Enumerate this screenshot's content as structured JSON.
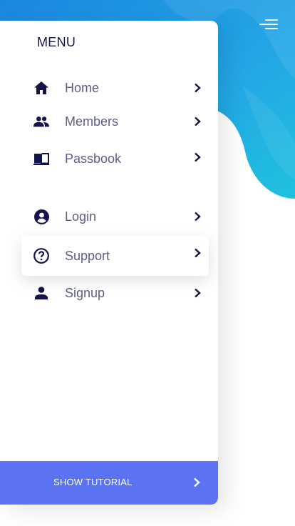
{
  "colors": {
    "accent": "#5b73f2",
    "background_wave_light": "#29b7e4",
    "background_wave_dark": "#1a8fe0",
    "menu_title": "#14134a",
    "item_text": "#5d5f86"
  },
  "header": {
    "menu_button_icon": "hamburger-icon"
  },
  "drawer": {
    "title": "MENU",
    "items": [
      {
        "label": "Home",
        "icon": "home-icon",
        "active": false
      },
      {
        "label": "Members",
        "icon": "people-icon",
        "active": false
      },
      {
        "label": "Passbook",
        "icon": "book-icon",
        "active": false
      },
      {
        "label": "Login",
        "icon": "account-circle-icon",
        "active": false
      },
      {
        "label": "Support",
        "icon": "help-circle-icon",
        "active": true
      },
      {
        "label": "Signup",
        "icon": "person-icon",
        "active": false
      }
    ],
    "footer_button": {
      "label": "SHOW TUTORIAL",
      "icon": "chevron-right-icon"
    }
  }
}
